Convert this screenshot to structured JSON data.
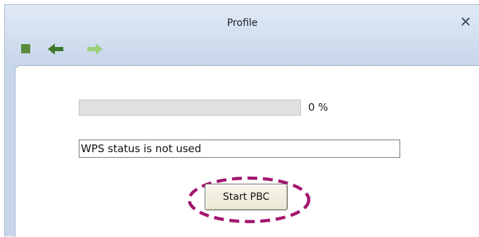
{
  "window": {
    "title": "Profile",
    "close_label": "✕"
  },
  "toolbar": {
    "items": [
      {
        "name": "stop-icon",
        "color": "#5a8a3c"
      },
      {
        "name": "back-arrow-icon",
        "color": "#3f7a2e"
      },
      {
        "name": "forward-arrow-icon",
        "color": "#9ccf7a"
      }
    ]
  },
  "wps": {
    "progress": 0,
    "percent_label": "0 %",
    "status_text": "WPS status is not used",
    "start_button_label": "Start PBC"
  },
  "colors": {
    "highlight": "#a4166e",
    "progress_fill": "#4fae4a"
  }
}
